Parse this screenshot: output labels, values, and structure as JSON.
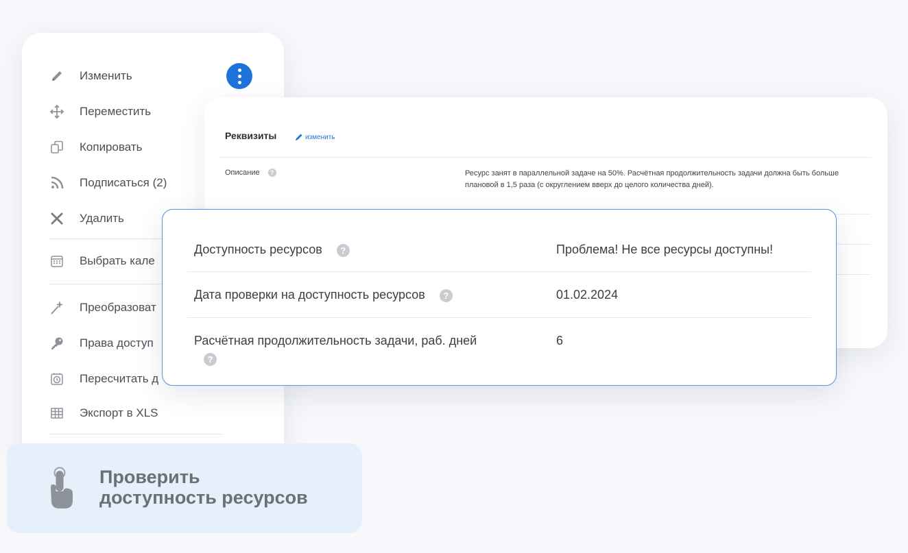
{
  "menu": {
    "items": [
      {
        "label": "Изменить",
        "icon": "pencil-icon"
      },
      {
        "label": "Переместить",
        "icon": "move-icon"
      },
      {
        "label": "Копировать",
        "icon": "copy-icon"
      },
      {
        "label": "Подписаться (2)",
        "icon": "rss-icon"
      },
      {
        "label": "Удалить",
        "icon": "close-icon"
      },
      {
        "label": "Выбрать кале",
        "icon": "calendar-icon"
      },
      {
        "label": "Преобразоват",
        "icon": "magic-wand-icon"
      },
      {
        "label": "Права доступ",
        "icon": "key-icon"
      },
      {
        "label": "Пересчитать д",
        "icon": "clock-calendar-icon"
      },
      {
        "label": "Экспорт в XLS",
        "icon": "table-grid-icon"
      }
    ]
  },
  "requisites": {
    "title": "Реквизиты",
    "edit_link": "изменить",
    "description_label": "Описание",
    "description_text": "Ресурс занят в параллельной задаче на 50%. Расчётная продолжительность задачи должна быть больше плановой в 1,5 раза (с округлением вверх до целого количества дней)."
  },
  "availability": {
    "rows": [
      {
        "label": "Доступность ресурсов",
        "value": "Проблема! Не все ресурсы доступны!"
      },
      {
        "label": "Дата проверки на доступность ресурсов",
        "value": "01.02.2024"
      },
      {
        "label": "Расчётная продолжительность задачи, раб. дней",
        "value": "6"
      }
    ],
    "help_glyph": "?"
  },
  "cta": {
    "line1": "Проверить",
    "line2": "доступность ресурсов"
  },
  "colors": {
    "accent": "#1e73d8",
    "card_border": "#5b8fe0",
    "cta_background": "#e6f0fb"
  }
}
